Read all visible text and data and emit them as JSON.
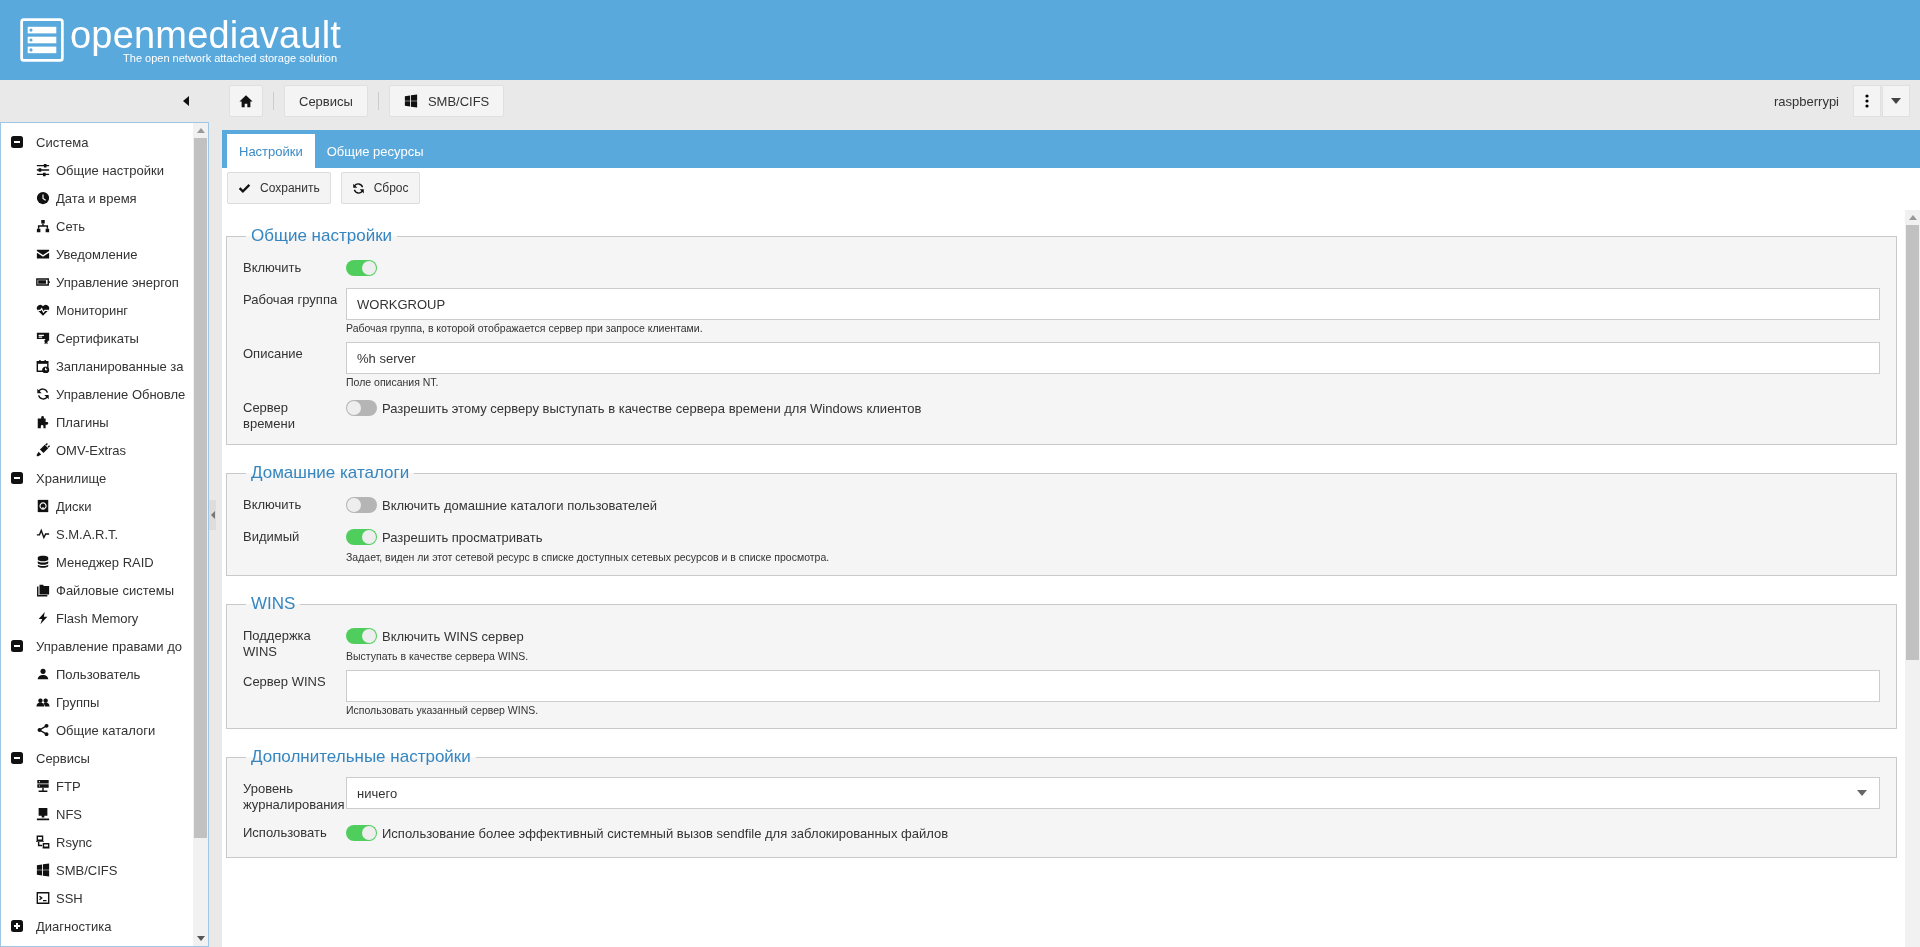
{
  "header": {
    "title": "openmediavault",
    "subtitle": "The open network attached storage solution"
  },
  "breadcrumb": [
    {
      "label": "Сервисы"
    },
    {
      "label": "SMB/CIFS"
    }
  ],
  "hostname": "raspberrypi",
  "sidebar": [
    {
      "label": "Система",
      "expanded": true,
      "children": [
        {
          "label": "Общие настройки"
        },
        {
          "label": "Дата и время"
        },
        {
          "label": "Сеть"
        },
        {
          "label": "Уведомление"
        },
        {
          "label": "Управление энергоп"
        },
        {
          "label": "Мониторинг"
        },
        {
          "label": "Сертификаты"
        },
        {
          "label": "Запланированные за"
        },
        {
          "label": "Управление Обновле"
        },
        {
          "label": "Плагины"
        },
        {
          "label": "OMV-Extras"
        }
      ]
    },
    {
      "label": "Хранилище",
      "expanded": true,
      "children": [
        {
          "label": "Диски"
        },
        {
          "label": "S.M.A.R.T."
        },
        {
          "label": "Менеджер RAID"
        },
        {
          "label": "Файловые системы"
        },
        {
          "label": "Flash Memory"
        }
      ]
    },
    {
      "label": "Управление правами до",
      "expanded": true,
      "children": [
        {
          "label": "Пользователь"
        },
        {
          "label": "Группы"
        },
        {
          "label": "Общие каталоги"
        }
      ]
    },
    {
      "label": "Сервисы",
      "expanded": true,
      "children": [
        {
          "label": "FTP"
        },
        {
          "label": "NFS"
        },
        {
          "label": "Rsync"
        },
        {
          "label": "SMB/CIFS"
        },
        {
          "label": "SSH"
        }
      ]
    },
    {
      "label": "Диагностика",
      "expanded": false
    }
  ],
  "tabs": [
    {
      "label": "Настройки",
      "selected": true
    },
    {
      "label": "Общие ресурсы",
      "selected": false
    }
  ],
  "actions": [
    {
      "label": "Сохранить"
    },
    {
      "label": "Сброс"
    }
  ],
  "sections": [
    {
      "title": "Общие настройки",
      "fields": [
        {
          "kind": "toggle",
          "label": "Включить",
          "on": true
        },
        {
          "kind": "text",
          "label": "Рабочая группа",
          "value": "WORKGROUP",
          "help": "Рабочая группа, в которой отображается сервер при запросе клиентами."
        },
        {
          "kind": "text",
          "label": "Описание",
          "value": "%h server",
          "help": "Поле описания NT."
        },
        {
          "kind": "toggle",
          "label": "Сервер времени",
          "on": false,
          "text": "Разрешить этому серверу выступать в качестве сервера времени для Windows клиентов"
        }
      ]
    },
    {
      "title": "Домашние каталоги",
      "fields": [
        {
          "kind": "toggle",
          "label": "Включить",
          "on": false,
          "text": "Включить домашние каталоги пользователей"
        },
        {
          "kind": "toggle",
          "label": "Видимый",
          "on": true,
          "text": "Разрешить просматривать",
          "help": "Задает, виден ли этот сетевой ресурс в списке доступных сетевых ресурсов и в списке просмотра."
        }
      ]
    },
    {
      "title": "WINS",
      "fields": [
        {
          "kind": "toggle",
          "label": "Поддержка WINS",
          "on": true,
          "text": "Включить WINS сервер",
          "help": "Выступать в качестве сервера WINS."
        },
        {
          "kind": "text",
          "label": "Сервер WINS",
          "help": "Использовать указанный сервер WINS."
        }
      ]
    },
    {
      "title": "Дополнительные настройки",
      "fields": [
        {
          "kind": "select",
          "label": "Уровень журналирования",
          "value": "ничего"
        },
        {
          "kind": "toggle",
          "label": "Использовать",
          "on": true,
          "text": "Использование более эффективный системный вызов sendfile для заблокированных файлов"
        }
      ]
    }
  ]
}
